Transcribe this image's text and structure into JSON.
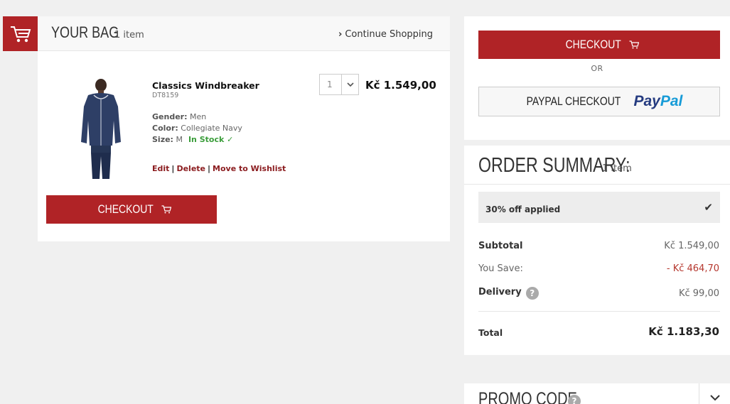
{
  "bag": {
    "title": "YOUR BAG",
    "count": "1 item",
    "continue_label": "Continue Shopping",
    "checkout_label": "CHECKOUT"
  },
  "product": {
    "name": "Classics Windbreaker",
    "sku": "DT8159",
    "gender_label": "Gender:",
    "gender": "Men",
    "color_label": "Color:",
    "color": "Collegiate Navy",
    "size_label": "Size:",
    "size": "M",
    "stock": "In Stock ✓",
    "edit": "Edit",
    "delete": "Delete",
    "wishlist": "Move to Wishlist",
    "quantity": "1",
    "price": "Kč 1.549,00"
  },
  "checkout_panel": {
    "checkout_label": "CHECKOUT",
    "or_label": "OR",
    "paypal_label": "PAYPAL CHECKOUT",
    "paypal_logo_pay": "Pay",
    "paypal_logo_pal": "Pal"
  },
  "summary": {
    "title": "ORDER SUMMARY:",
    "count": "1 item",
    "discount": "30% off applied",
    "subtotal_label": "Subtotal",
    "subtotal": "Kč 1.549,00",
    "save_label": "You Save:",
    "save": "- Kč 464,70",
    "delivery_label": "Delivery",
    "delivery": "Kč 99,00",
    "total_label": "Total",
    "total": "Kč 1.183,30"
  },
  "promo": {
    "title": "PROMO CODE"
  },
  "colors": {
    "accent": "#b02326",
    "stock": "#3a9d3a",
    "link": "#8b1c1f"
  }
}
